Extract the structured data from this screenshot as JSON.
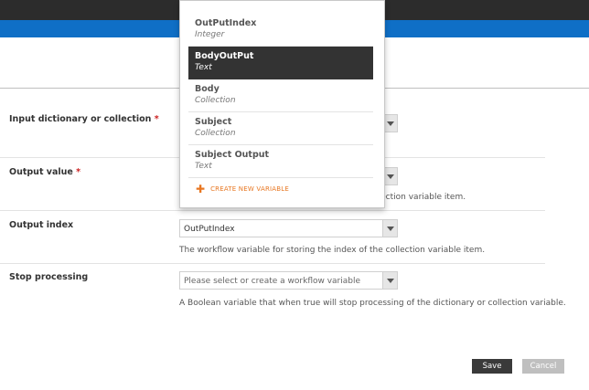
{
  "form": {
    "rows": [
      {
        "label": "Input dictionary or collection",
        "required_mark": "*"
      },
      {
        "label": "Output value",
        "required_mark": "*",
        "help": "onary or collection variable item."
      },
      {
        "label": "Output index",
        "value": "OutPutIndex",
        "help": "The workflow variable for storing the index of the collection variable item."
      },
      {
        "label": "Stop processing",
        "placeholder": "Please select or create a workflow variable",
        "help": "A Boolean variable that when true will stop processing of the dictionary or collection variable."
      }
    ]
  },
  "dropdown": {
    "items": [
      {
        "name": "OutPutIndex",
        "type": "Integer",
        "selected": false
      },
      {
        "name": "BodyOutPut",
        "type": "Text",
        "selected": true
      },
      {
        "name": "Body",
        "type": "Collection",
        "selected": false
      },
      {
        "name": "Subject",
        "type": "Collection",
        "selected": false
      },
      {
        "name": "Subject Output",
        "type": "Text",
        "selected": false
      }
    ],
    "create_label": "CREATE NEW VARIABLE",
    "create_icon": "plus-icon"
  },
  "buttons": {
    "save": "Save",
    "cancel": "Cancel"
  },
  "colors": {
    "accent_blue": "#0f6fc6",
    "create_orange": "#e87722",
    "selected_bg": "#333333",
    "required_red": "#cc2222"
  }
}
